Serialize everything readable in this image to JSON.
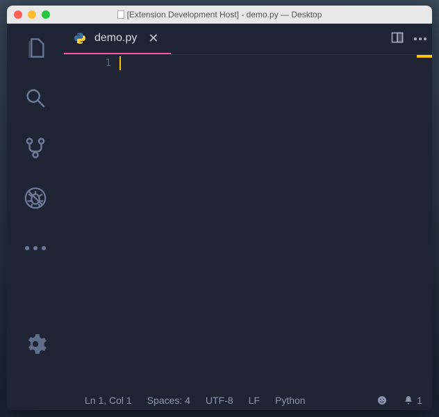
{
  "titlebar": {
    "prefix": "[Extension Development Host]",
    "filename": "demo.py",
    "location": "Desktop"
  },
  "tab": {
    "label": "demo.py"
  },
  "editor": {
    "line_numbers": [
      "1"
    ]
  },
  "status": {
    "cursor": "Ln 1, Col 1",
    "spaces": "Spaces: 4",
    "encoding": "UTF-8",
    "eol": "LF",
    "language": "Python",
    "notifications": "1"
  }
}
